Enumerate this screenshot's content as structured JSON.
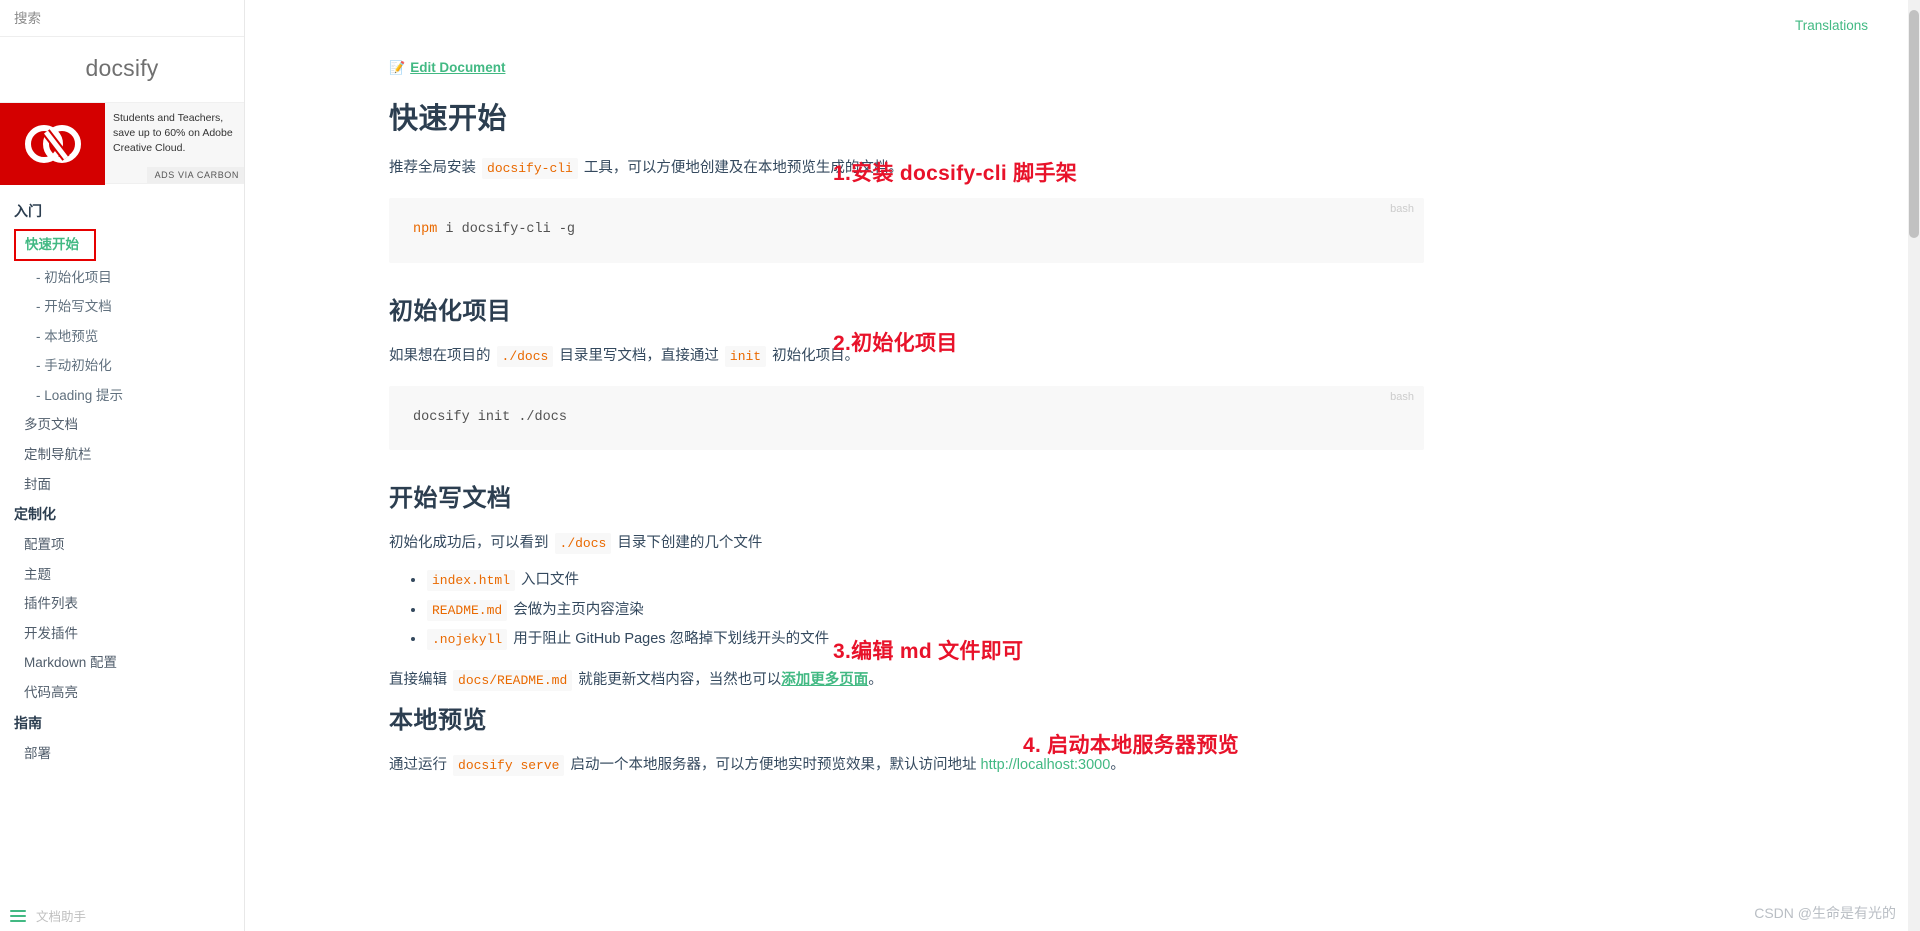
{
  "sidebar": {
    "search": {
      "placeholder": "搜索",
      "value": ""
    },
    "brand": "docsify",
    "ad": {
      "text": "Students and Teachers, save up to 60% on Adobe Creative Cloud.",
      "powered_by": "ADS VIA CARBON",
      "logo_color": "#d40000"
    },
    "groups": [
      {
        "title": "入门",
        "items": [
          {
            "label": "快速开始",
            "level": 1,
            "active": true
          },
          {
            "label": "- 初始化项目",
            "level": 2,
            "active": false
          },
          {
            "label": "- 开始写文档",
            "level": 2,
            "active": false
          },
          {
            "label": "- 本地预览",
            "level": 2,
            "active": false
          },
          {
            "label": "- 手动初始化",
            "level": 2,
            "active": false
          },
          {
            "label": "- Loading 提示",
            "level": 2,
            "active": false
          },
          {
            "label": "多页文档",
            "level": 1,
            "active": false
          },
          {
            "label": "定制导航栏",
            "level": 1,
            "active": false
          },
          {
            "label": "封面",
            "level": 1,
            "active": false
          }
        ]
      },
      {
        "title": "定制化",
        "items": [
          {
            "label": "配置项",
            "level": 1,
            "active": false
          },
          {
            "label": "主题",
            "level": 1,
            "active": false
          },
          {
            "label": "插件列表",
            "level": 1,
            "active": false
          },
          {
            "label": "开发插件",
            "level": 1,
            "active": false
          },
          {
            "label": "Markdown 配置",
            "level": 1,
            "active": false
          },
          {
            "label": "代码高亮",
            "level": 1,
            "active": false
          }
        ]
      },
      {
        "title": "指南",
        "items": [
          {
            "label": "部署",
            "level": 1,
            "active": false
          }
        ]
      }
    ],
    "toggle_label": "文档助手"
  },
  "header": {
    "translations": "Translations"
  },
  "main": {
    "edit_icon": "memo-icon",
    "edit_label": "Edit Document",
    "sections": [
      {
        "id": "quickstart",
        "heading": "快速开始",
        "heading_level": 1,
        "para_pre": "推荐全局安装",
        "para_code": "docsify-cli",
        "para_post": "工具，可以方便地创建及在本地预览生成的文档。",
        "code_lang": "bash",
        "code_kw": "npm",
        "code_rest": " i docsify-cli -g"
      },
      {
        "id": "init",
        "heading": "初始化项目",
        "heading_level": 2,
        "para_pre": "如果想在项目的",
        "para_code": "./docs",
        "para_mid": "目录里写文档，直接通过",
        "para_code2": "init",
        "para_post": "初始化项目。",
        "code_lang": "bash",
        "code_rest": "docsify init ./docs"
      },
      {
        "id": "writing",
        "heading": "开始写文档",
        "heading_level": 2,
        "para_pre": "初始化成功后，可以看到",
        "para_code": "./docs",
        "para_post": "目录下创建的几个文件",
        "bullets": [
          {
            "code": "index.html",
            "text": "入口文件"
          },
          {
            "code": "README.md",
            "text": "会做为主页内容渲染"
          },
          {
            "code": ".nojekyll",
            "text": "用于阻止 GitHub Pages 忽略掉下划线开头的文件"
          }
        ],
        "edit_pre": "直接编辑",
        "edit_code": "docs/README.md",
        "edit_mid": "就能更新文档内容，当然也可以",
        "edit_link": "添加更多页面",
        "edit_post": "。"
      },
      {
        "id": "preview",
        "heading": "本地预览",
        "heading_level": 2,
        "para_pre": "通过运行",
        "para_code": "docsify serve",
        "para_mid": "启动一个本地服务器，可以方便地实时预览效果，默认访问地址",
        "para_link": "http://localhost:3000",
        "para_post": "。"
      }
    ],
    "annotations": [
      {
        "id": "annot-1",
        "text": "1.安装 docsify-cli 脚手架"
      },
      {
        "id": "annot-2",
        "text": "2.初始化项目"
      },
      {
        "id": "annot-3",
        "text": "3.编辑 md 文件即可"
      },
      {
        "id": "annot-4",
        "text": "4. 启动本地服务器预览"
      }
    ]
  },
  "watermark": "CSDN @生命是有光的",
  "colors": {
    "accent_green": "#42b983",
    "annotation_red": "#e8122a",
    "heading": "#2c3e50",
    "code_orange": "#e96900",
    "code_bg": "#f8f8f8"
  }
}
